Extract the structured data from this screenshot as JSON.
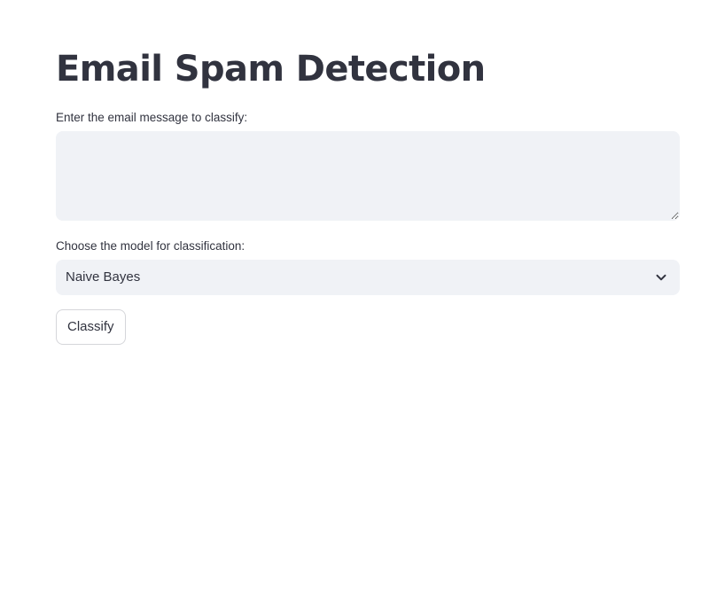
{
  "page": {
    "title": "Email Spam Detection"
  },
  "message_input": {
    "label": "Enter the email message to classify:",
    "value": "",
    "placeholder": ""
  },
  "model_select": {
    "label": "Choose the model for classification:",
    "selected": "Naive Bayes",
    "icon": "chevron-down-icon"
  },
  "classify_button": {
    "label": "Classify"
  },
  "colors": {
    "text": "#31333f",
    "input_background": "#f0f2f6",
    "button_border": "#d5d6da",
    "page_background": "#ffffff"
  }
}
